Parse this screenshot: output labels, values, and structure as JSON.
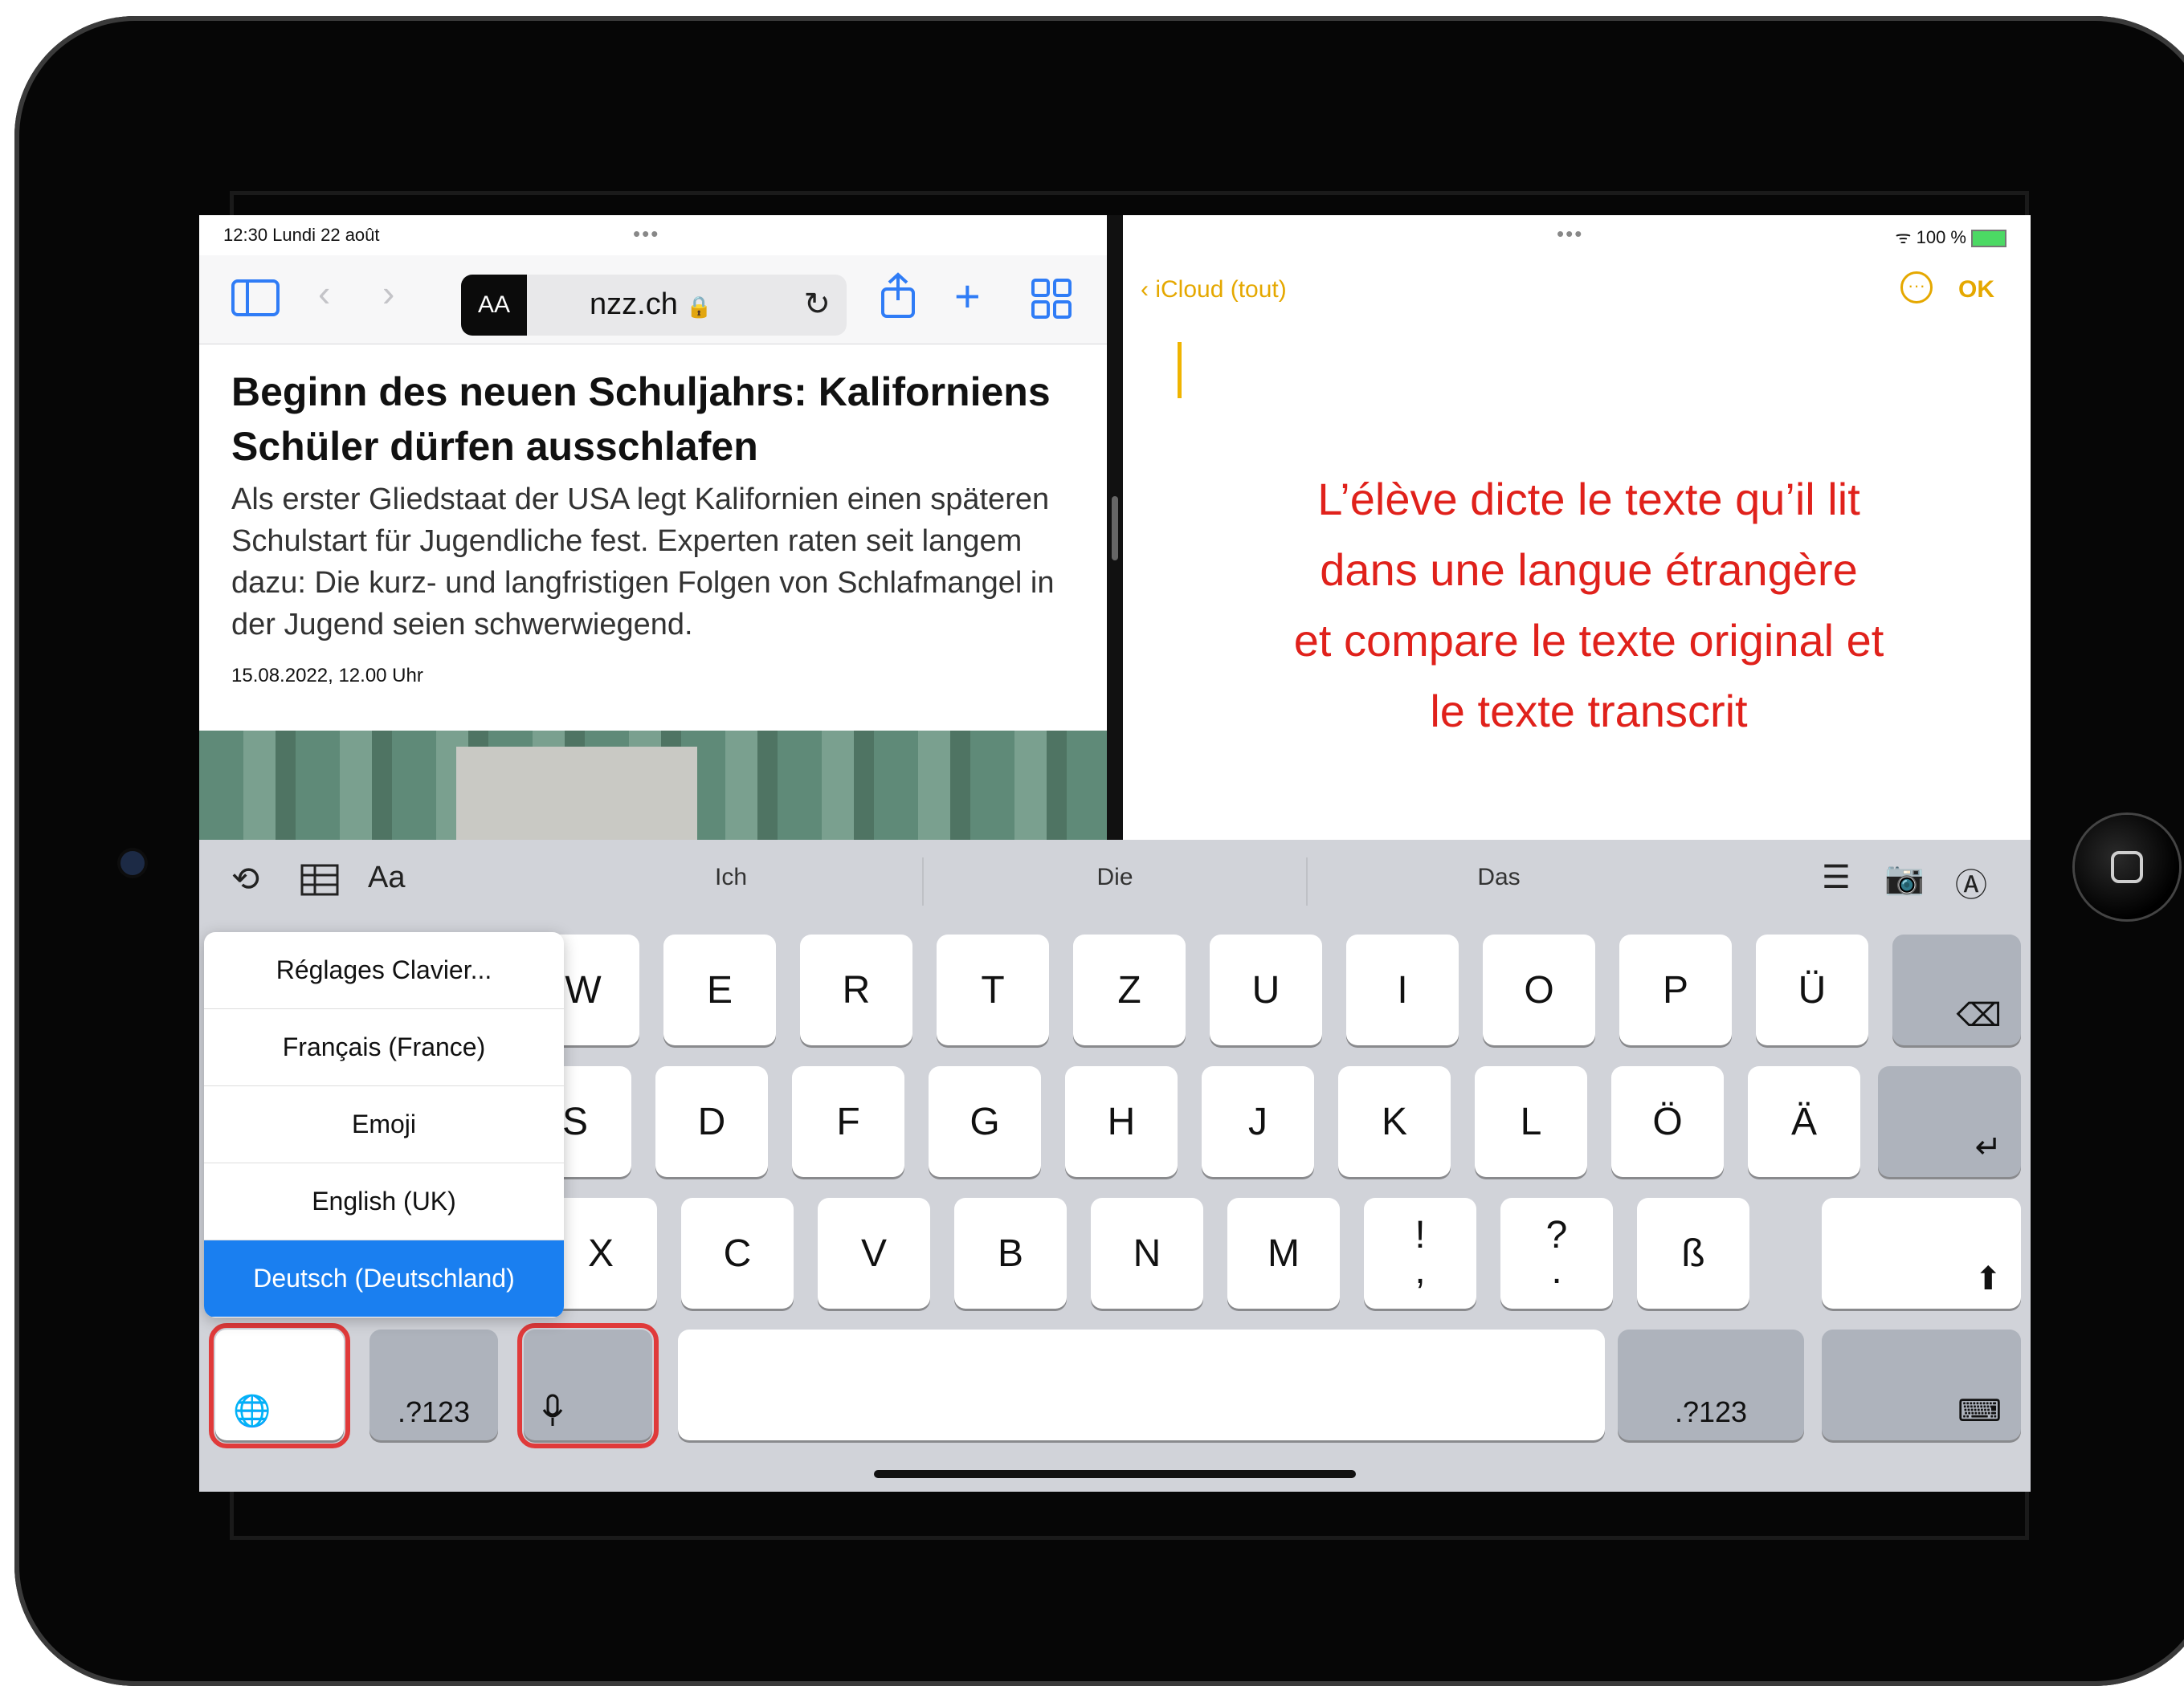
{
  "status": {
    "time_date": "12:30  Lundi 22 août",
    "multitask_dots": "•••",
    "wifi": "wifi-icon",
    "battery": "100 %"
  },
  "safari": {
    "text_size_button": "AA",
    "address": "nzz.ch",
    "lock": "🔒",
    "reload": "↻",
    "article": {
      "headline": "Beginn des neuen Schuljahrs: Kaliforniens Schüler dürfen ausschlafen",
      "lead": "Als erster Gliedstaat der USA legt Kalifornien einen späteren Schulstart für Jugendliche fest. Experten raten seit langem dazu: Die kurz- und langfristigen Folgen von Schlafmangel in der Jugend seien schwerwiegend.",
      "date": "15.08.2022, 12.00 Uhr"
    }
  },
  "notes": {
    "back_label": "iCloud (tout)",
    "done_label": "OK",
    "annotation_lines": [
      "L’élève dicte le texte qu’il lit",
      "dans une langue étrangère",
      "et compare le texte original et",
      "le texte transcrit"
    ]
  },
  "keyboard": {
    "format_label": "Aa",
    "suggestions": [
      "Ich",
      "Die",
      "Das"
    ],
    "row1": [
      "W",
      "E",
      "R",
      "T",
      "Z",
      "U",
      "I",
      "O",
      "P",
      "Ü"
    ],
    "row2": [
      "S",
      "D",
      "F",
      "G",
      "H",
      "J",
      "K",
      "L",
      "Ö",
      "Ä"
    ],
    "row3": [
      "X",
      "C",
      "V",
      "B",
      "N",
      "M"
    ],
    "punct": [
      {
        "top": "!",
        "bottom": ","
      },
      {
        "top": "?",
        "bottom": "."
      }
    ],
    "eszett": "ß",
    "numbers_label": ".?123",
    "backspace": "⌫",
    "return": "↵",
    "shift": "⬆",
    "globe": "globe-icon",
    "mic": "microphone-icon",
    "hide_keyboard": "keyboard-hide-icon",
    "language_menu": [
      "Réglages Clavier...",
      "Français (France)",
      "Emoji",
      "English (UK)",
      "Deutsch (Deutschland)"
    ],
    "selected_language": "Deutsch (Deutschland)"
  },
  "colors": {
    "accent_notes": "#e5a800",
    "annotation_red": "#e0211b",
    "safari_blue": "#2f7cf6",
    "highlight_red": "#e03a3a"
  }
}
